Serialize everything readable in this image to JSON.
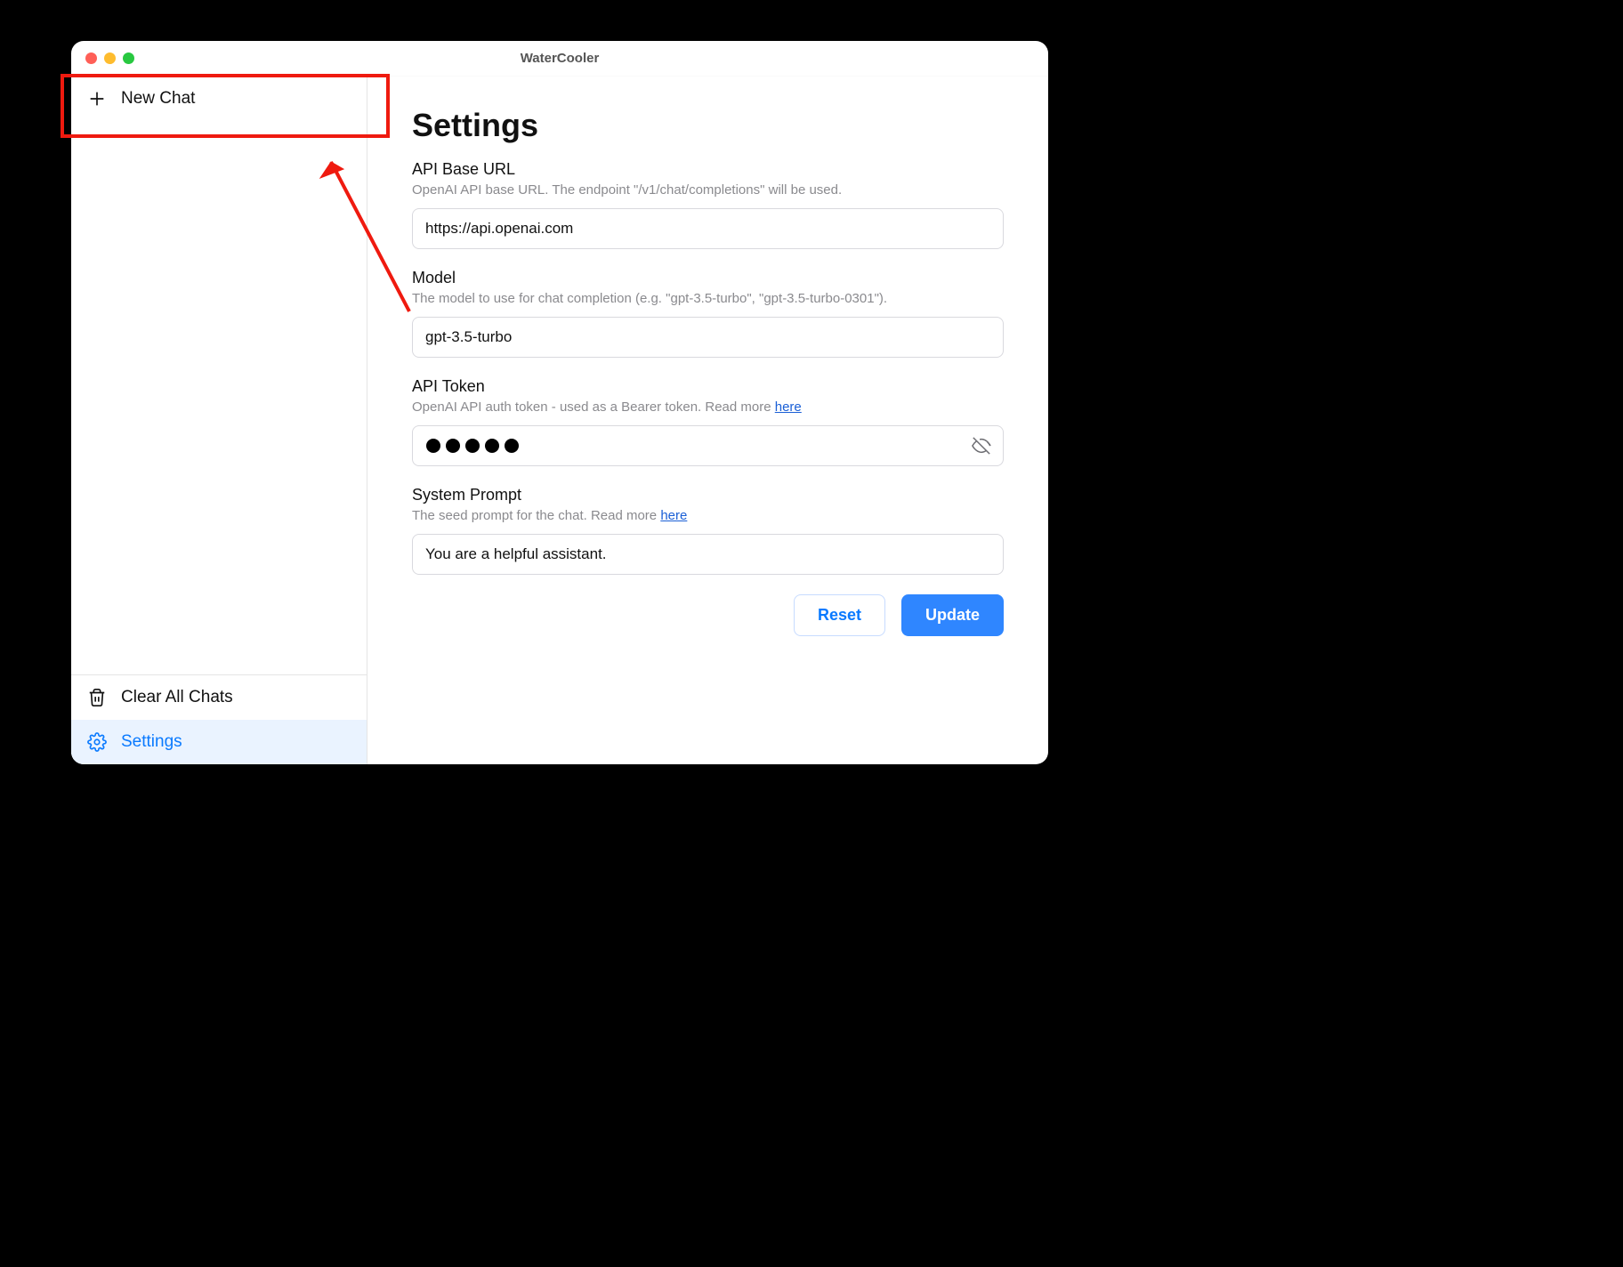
{
  "window": {
    "title": "WaterCooler"
  },
  "sidebar": {
    "new_chat": "New Chat",
    "clear_all": "Clear All Chats",
    "settings": "Settings"
  },
  "settings": {
    "heading": "Settings",
    "api_base_url": {
      "label": "API Base URL",
      "help": "OpenAI API base URL. The endpoint \"/v1/chat/completions\" will be used.",
      "value": "https://api.openai.com"
    },
    "model": {
      "label": "Model",
      "help": "The model to use for chat completion (e.g. \"gpt-3.5-turbo\", \"gpt-3.5-turbo-0301\").",
      "value": "gpt-3.5-turbo"
    },
    "api_token": {
      "label": "API Token",
      "help_prefix": "OpenAI API auth token - used as a Bearer token. Read more ",
      "help_link": "here",
      "masked_dots": 5
    },
    "system_prompt": {
      "label": "System Prompt",
      "help_prefix": "The seed prompt for the chat. Read more ",
      "help_link": "here",
      "value": "You are a helpful assistant."
    },
    "buttons": {
      "reset": "Reset",
      "update": "Update"
    }
  }
}
